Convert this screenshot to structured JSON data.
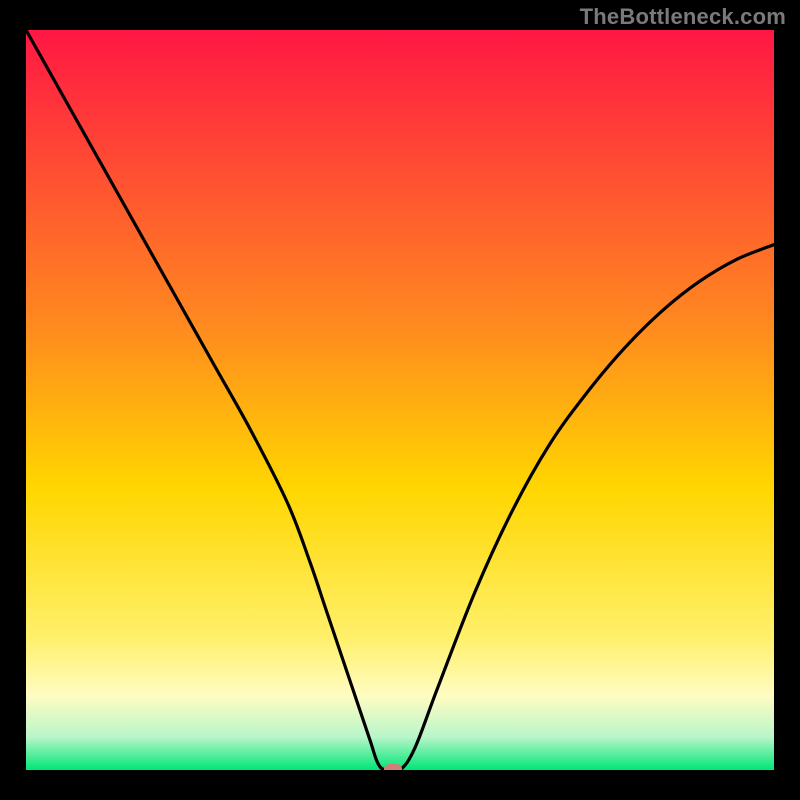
{
  "watermark": "TheBottleneck.com",
  "chart_data": {
    "type": "line",
    "title": "",
    "xlabel": "",
    "ylabel": "",
    "xlim": [
      0,
      100
    ],
    "ylim": [
      0,
      100
    ],
    "x": [
      0,
      5,
      10,
      15,
      20,
      25,
      30,
      35,
      38,
      40,
      42,
      44,
      46,
      47,
      48,
      50,
      52,
      55,
      60,
      65,
      70,
      75,
      80,
      85,
      90,
      95,
      100
    ],
    "values": [
      100,
      91,
      82,
      73,
      64,
      55,
      46,
      36,
      28,
      22,
      16,
      10,
      4,
      1,
      0,
      0,
      3,
      11,
      24,
      35,
      44,
      51,
      57,
      62,
      66,
      69,
      71
    ],
    "annotations": [
      {
        "type": "marker",
        "x": 49,
        "y": 0,
        "shape": "pill",
        "color": "#d18079"
      }
    ],
    "background": {
      "type": "vertical-gradient",
      "stops": [
        {
          "pos": 0.0,
          "color": "#ff1744"
        },
        {
          "pos": 0.4,
          "color": "#ff8a1f"
        },
        {
          "pos": 0.62,
          "color": "#ffd600"
        },
        {
          "pos": 0.82,
          "color": "#fff06a"
        },
        {
          "pos": 0.9,
          "color": "#fffcc2"
        },
        {
          "pos": 0.955,
          "color": "#b9f6ca"
        },
        {
          "pos": 1.0,
          "color": "#00e676"
        }
      ]
    }
  }
}
